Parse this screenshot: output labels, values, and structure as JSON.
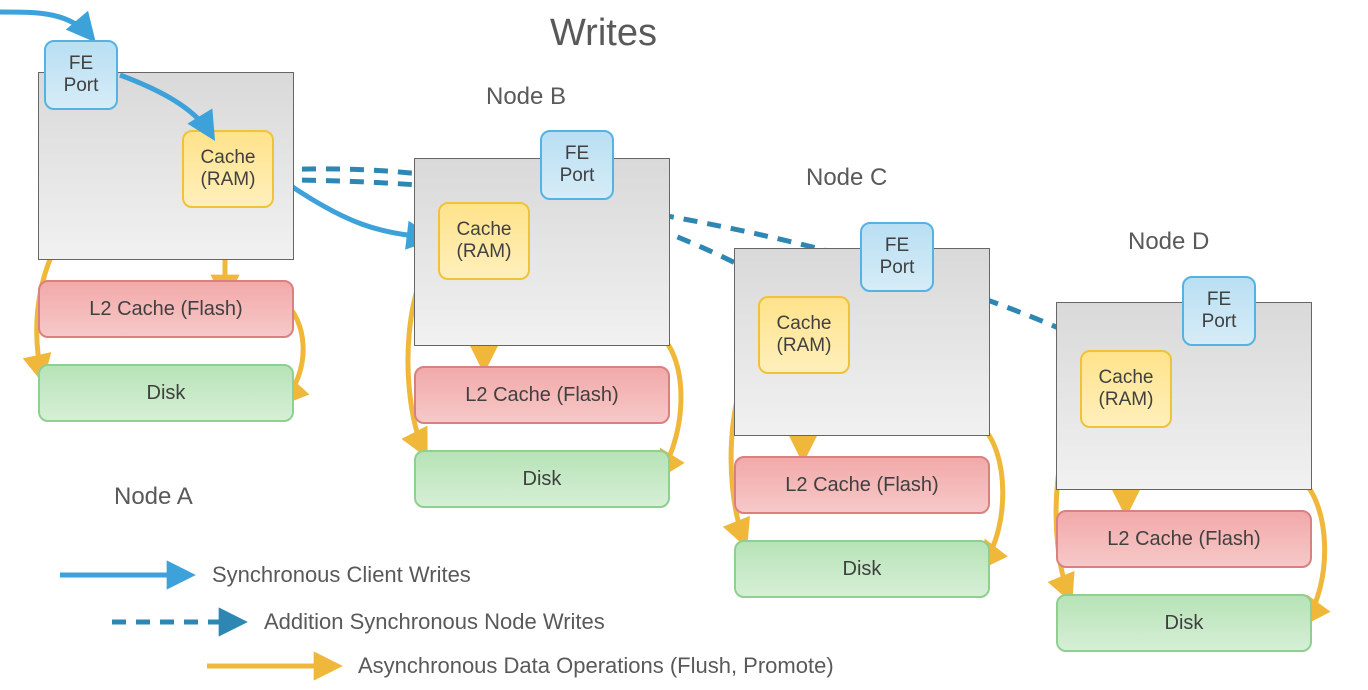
{
  "title": "Writes",
  "nodes": {
    "A": {
      "label": "Node A",
      "fe": "FE\nPort",
      "cache": "Cache\n(RAM)",
      "l2": "L2 Cache (Flash)",
      "disk": "Disk"
    },
    "B": {
      "label": "Node B",
      "fe": "FE\nPort",
      "cache": "Cache\n(RAM)",
      "l2": "L2 Cache (Flash)",
      "disk": "Disk"
    },
    "C": {
      "label": "Node C",
      "fe": "FE\nPort",
      "cache": "Cache\n(RAM)",
      "l2": "L2 Cache (Flash)",
      "disk": "Disk"
    },
    "D": {
      "label": "Node D",
      "fe": "FE\nPort",
      "cache": "Cache\n(RAM)",
      "l2": "L2 Cache (Flash)",
      "disk": "Disk"
    }
  },
  "legend": {
    "sync": "Synchronous Client Writes",
    "async_node": "Addition Synchronous Node Writes",
    "async_data": "Asynchronous Data Operations (Flush, Promote)"
  },
  "colors": {
    "blue": "#3ca2d9",
    "yellow": "#f0b83a",
    "gray_text": "#595959"
  }
}
